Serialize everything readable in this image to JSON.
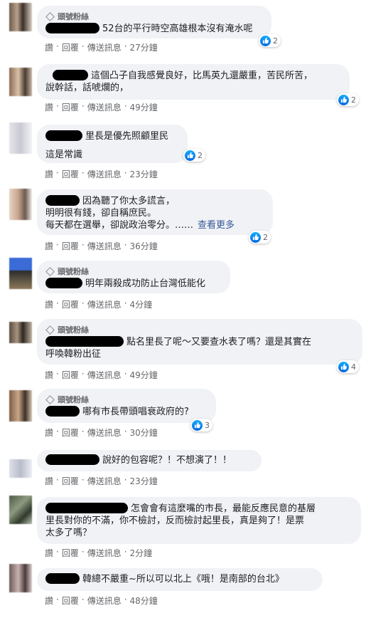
{
  "badge_label": "頭號粉絲",
  "actions": {
    "like": "讚",
    "reply": "回覆",
    "message": "傳送訊息"
  },
  "comments": [
    {
      "fan": true,
      "text": "52台的平行時空高雄根本沒有淹水呢",
      "likes": "2",
      "time": "27分鐘"
    },
    {
      "fan": false,
      "line1": "這個凸子自我感覺良好，比馬英九還嚴重，苦民所苦，",
      "line2": "說幹話，話唬爛的，",
      "likes": "2",
      "time": "49分鐘"
    },
    {
      "fan": false,
      "line1": "里長是優先照顧里民",
      "line2": "這是常識",
      "likes": "2",
      "time": "23分鐘"
    },
    {
      "fan": false,
      "line1": "因為聽了你太多謊言，",
      "line2": "明明很有錢，卻自稱庶民。",
      "line3": "每天都在選舉，卻說政治零分。……",
      "more": "查看更多",
      "likes": "2",
      "time": "36分鐘"
    },
    {
      "fan": true,
      "text": "明年兩殺成功防止台灣低能化",
      "time": "4分鐘"
    },
    {
      "fan": true,
      "line1": "點名里長了呢～又要查水表了嗎？還是其實在",
      "line2": "呼喚韓粉出征",
      "likes": "4",
      "time": "49分鐘"
    },
    {
      "fan": true,
      "text": "哪有市長帶頭唱衰政府的?",
      "likes": "3",
      "time": "30分鐘"
    },
    {
      "fan": false,
      "text": "說好的包容呢？！不想演了！！",
      "time": "23分鐘"
    },
    {
      "fan": false,
      "line1": "怎會會有這麼嘴的市長，最能反應民意的基層",
      "line2": "里長對你的不滿，你不檢討，反而檢討起里長，真是夠了！是票",
      "line3": "太多了嗎？",
      "time": "2分鐘"
    },
    {
      "fan": false,
      "text": "韓總不嚴重~所以可以北上《哦！是南部的台北》",
      "time": "48分鐘"
    }
  ]
}
